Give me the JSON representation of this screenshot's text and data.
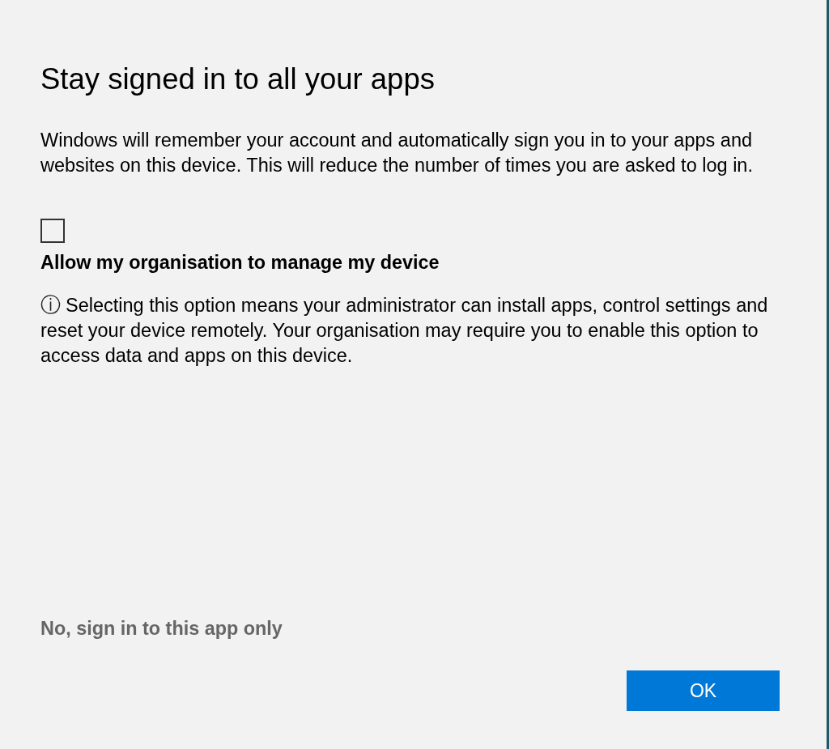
{
  "dialog": {
    "title": "Stay signed in to all your apps",
    "description": "Windows will remember your account and automatically sign you in to your apps and websites on this device. This will reduce the number of times you are asked to log in.",
    "checkbox": {
      "checked": false,
      "label": "Allow my organisation to manage my device"
    },
    "info": {
      "icon": "ⓘ",
      "text": "Selecting this option means your administrator can install apps, control settings and reset your device remotely. Your organisation may require you to enable this option to access data and apps on this device."
    },
    "link": "No, sign in to this app only",
    "buttons": [
      "OK"
    ]
  }
}
